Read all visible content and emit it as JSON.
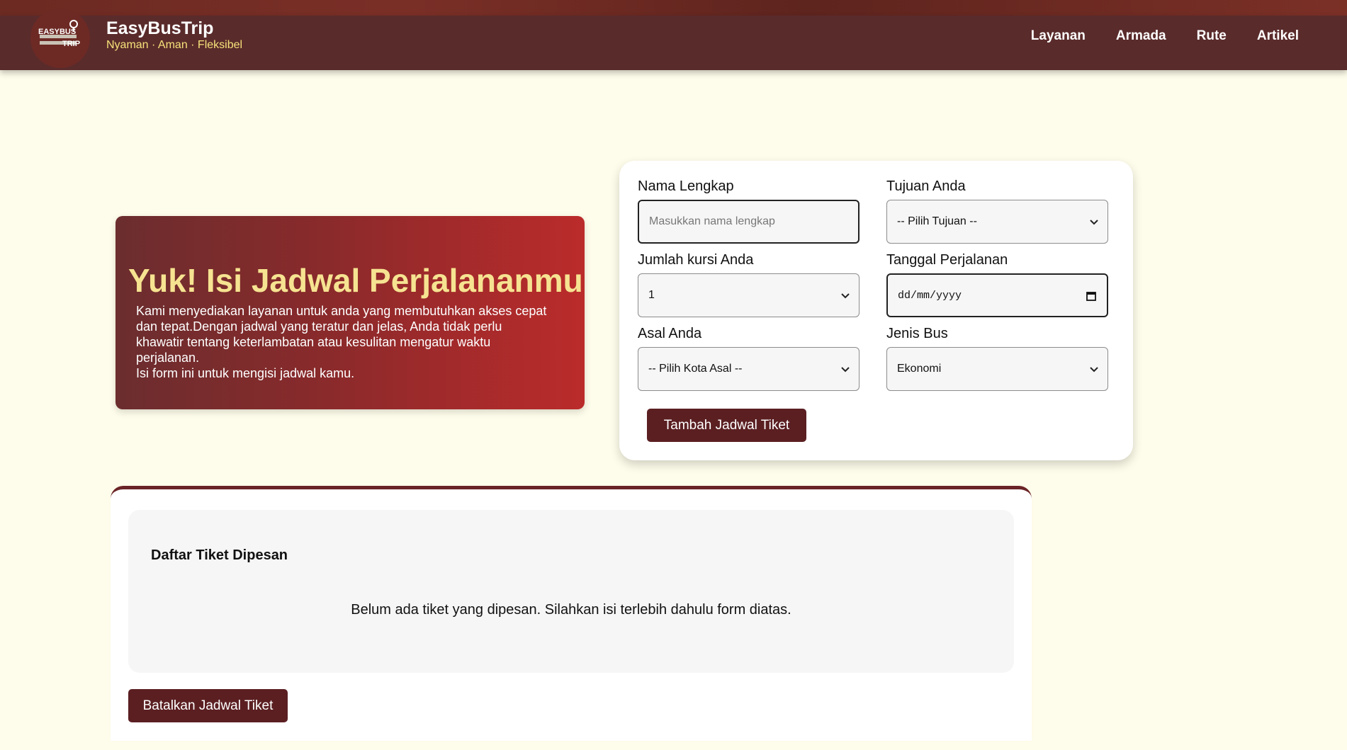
{
  "colors": {
    "header_bg": "#5a2b2b",
    "accent_yellow": "#f6e27a",
    "button_bg": "#5b1f22",
    "page_bg": "#fefcea",
    "hero_gradient_end": "#bb2b2b"
  },
  "header": {
    "logo_text_top": "EASYBUS",
    "logo_text_bottom": "TRIP",
    "brand_title": "EasyBusTrip",
    "brand_tagline": "Nyaman · Aman · Fleksibel",
    "nav": [
      {
        "label": "Layanan"
      },
      {
        "label": "Armada"
      },
      {
        "label": "Rute"
      },
      {
        "label": "Artikel"
      }
    ]
  },
  "hero": {
    "title": "Yuk! Isi Jadwal Perjalananmu",
    "description_line1": "Kami menyediakan layanan untuk anda yang membutuhkan akses cepat dan tepat.Dengan jadwal yang teratur dan jelas, Anda tidak perlu khawatir tentang keterlambatan atau kesulitan mengatur waktu perjalanan.",
    "description_line2": "Isi form ini untuk mengisi jadwal kamu."
  },
  "form": {
    "name_label": "Nama Lengkap",
    "name_placeholder": "Masukkan nama lengkap",
    "name_value": "",
    "destination_label": "Tujuan Anda",
    "destination_value": "-- Pilih Tujuan --",
    "seats_label": "Jumlah kursi Anda",
    "seats_value": "1",
    "date_label": "Tanggal Perjalanan",
    "date_value": "dd/mm/yyyy",
    "origin_label": "Asal Anda",
    "origin_value": "-- Pilih Kota Asal --",
    "bus_type_label": "Jenis Bus",
    "bus_type_value": "Ekonomi",
    "submit_label": "Tambah Jadwal Tiket"
  },
  "tickets": {
    "title": "Daftar Tiket Dipesan",
    "empty_message": "Belum ada tiket yang dipesan. Silahkan isi terlebih dahulu form diatas.",
    "cancel_label": "Batalkan Jadwal Tiket"
  }
}
